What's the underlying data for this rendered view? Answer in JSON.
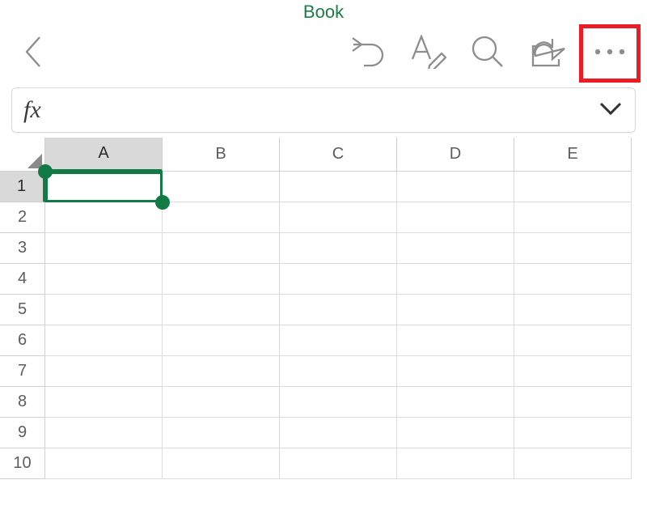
{
  "title": "Book",
  "formula_bar": {
    "fx_label": "fx",
    "value": ""
  },
  "columns": [
    "A",
    "B",
    "C",
    "D",
    "E"
  ],
  "rows": [
    "1",
    "2",
    "3",
    "4",
    "5",
    "6",
    "7",
    "8",
    "9",
    "10"
  ],
  "selection": {
    "cell": "A1",
    "active_column": "A",
    "active_row": "1"
  },
  "icons": {
    "back": "chevron-left",
    "undo": "undo",
    "edit_text": "font-pen",
    "search": "magnifier",
    "share": "share-arrow",
    "more": "ellipsis",
    "expand": "chevron-down",
    "select_all": "triangle"
  },
  "colors": {
    "accent": "#127b45",
    "title": "#1c7c46",
    "icon": "#8d8d8d",
    "highlight_box": "#ec1c24"
  }
}
